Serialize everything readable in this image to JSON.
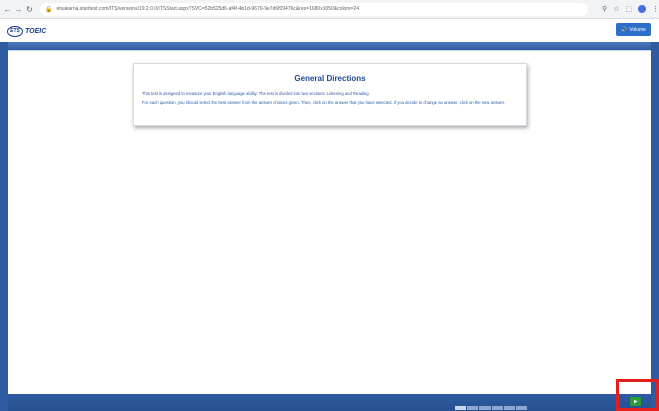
{
  "browser": {
    "url": "etsakarna.starttest.com/ITS/versions/19.2.0.0/ITSStart.aspx?SVC=52b525d6-af4f-4b1d-9670-9e7d6f09476c&res=1680x1050&colors=24"
  },
  "app": {
    "brand_badge": "ETS",
    "brand_name": "TOEIC",
    "volume_label": "Volume"
  },
  "directions": {
    "title": "General Directions",
    "paragraph1": "This test is designed to measure your English language ability. The test is divided into two sections: Listening and Reading.",
    "paragraph2": "For each question, you should select the best answer from the answer choices given. Then, click on the answer that you have selected. If you decide to change an answer, click on the new answer."
  },
  "colors": {
    "accent": "#2f5ba3",
    "next_button": "#2a9d3a",
    "highlight": "#e41d1d"
  },
  "icons": [
    "back-icon",
    "forward-icon",
    "reload-icon",
    "lock-icon",
    "zoom-icon",
    "star-icon",
    "extension-icon",
    "profile-icon",
    "menu-icon",
    "speaker-icon",
    "next-arrow-icon"
  ]
}
